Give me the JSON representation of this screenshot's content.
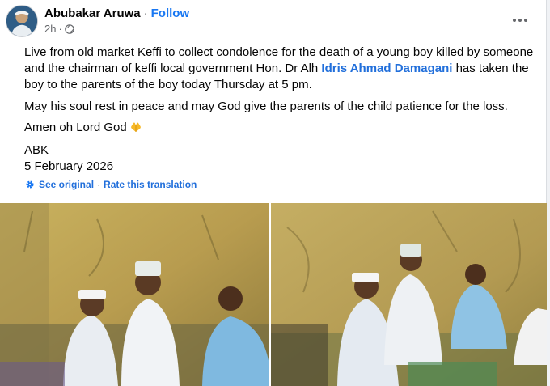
{
  "post": {
    "author": "Abubakar Aruwa",
    "separator": "·",
    "follow_label": "Follow",
    "timestamp": "2h",
    "timestamp_separator": "·",
    "paragraph1_before": "Live from old market Keffi to collect condolence for the death of a young boy killed by someone and the chairman of keffi local government Hon. Dr Alh ",
    "mention": "Idris Ahmad Damagani",
    "paragraph1_after": " has taken the boy to the parents of the boy today Thursday at 5 pm.",
    "paragraph2": "May his soul rest in peace and may God give the parents of the child patience for the loss.",
    "paragraph3": "Amen oh Lord God",
    "paragraph4": "ABK",
    "paragraph5": "5 February 2026",
    "see_original": "See original",
    "translation_separator": "·",
    "rate_translation": "Rate this translation"
  },
  "icons": {
    "privacy": "globe-icon",
    "more": "more-options-icon",
    "emoji": "praying-hands-icon",
    "translation": "gear-icon"
  },
  "colors": {
    "link": "#216fdb",
    "follow": "#1877f2",
    "secondary_text": "#65676b"
  }
}
